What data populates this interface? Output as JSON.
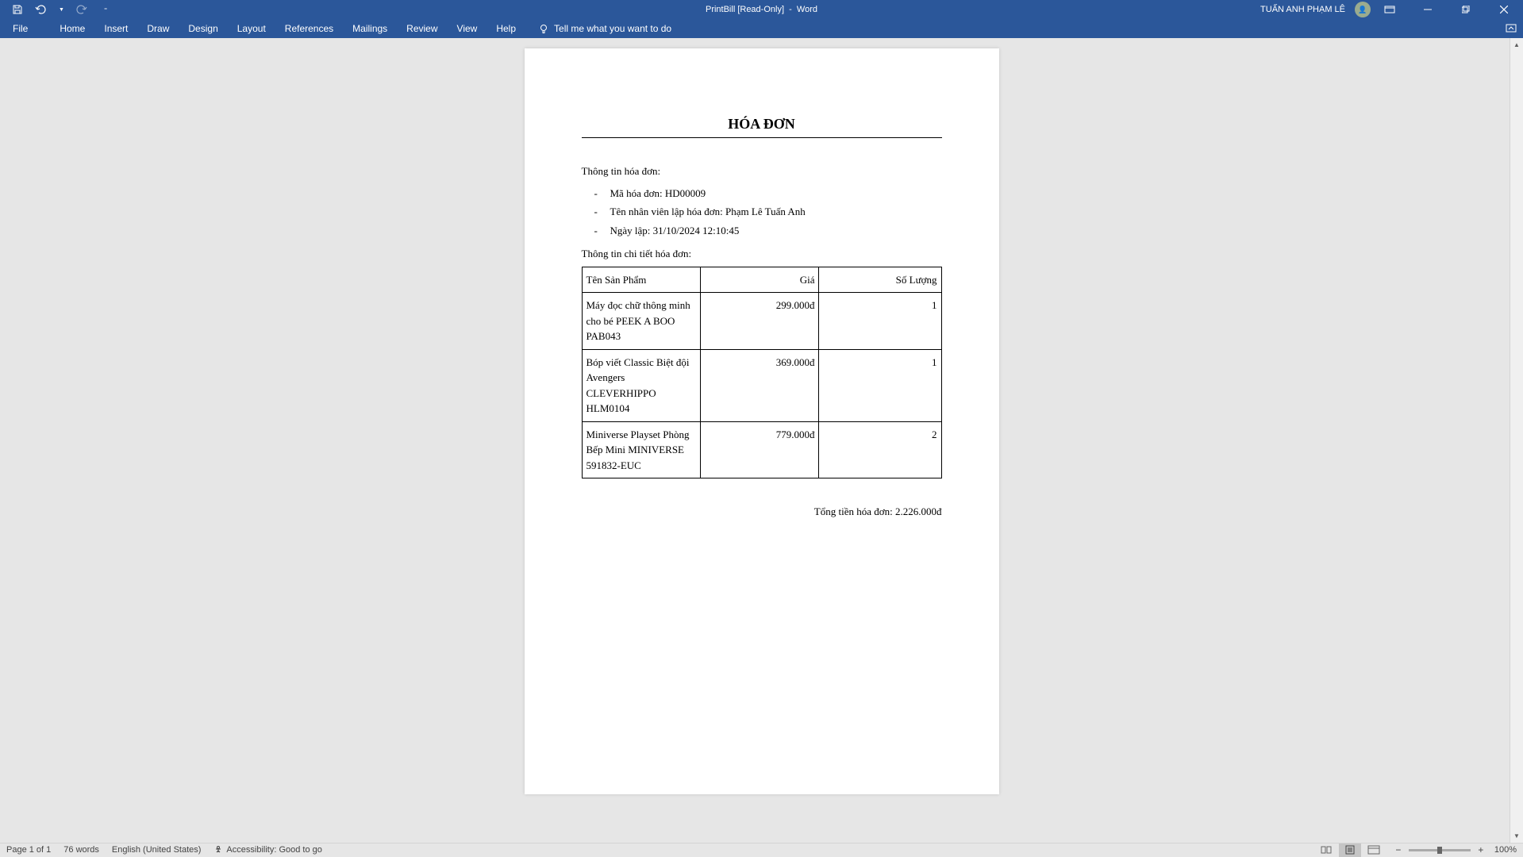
{
  "titleBar": {
    "docName": "PrintBill [Read-Only]",
    "appName": "Word",
    "userName": "TUẤN ANH PHẠM LÊ"
  },
  "ribbon": {
    "tabs": {
      "file": "File",
      "home": "Home",
      "insert": "Insert",
      "draw": "Draw",
      "design": "Design",
      "layout": "Layout",
      "references": "References",
      "mailings": "Mailings",
      "review": "Review",
      "view": "View",
      "help": "Help"
    },
    "tellMe": "Tell me what you want to do"
  },
  "document": {
    "title": "HÓA ĐƠN",
    "infoLabel": "Thông tin hóa đơn:",
    "info": {
      "billCodeLabel": "Mã hóa đơn: ",
      "billCode": "HD00009",
      "staffLabel": "Tên nhân viên lập hóa đơn: ",
      "staffName": "Phạm Lê Tuấn Anh",
      "dateLabel": "Ngày lập: ",
      "dateValue": "31/10/2024 12:10:45"
    },
    "detailLabel": "Thông tin chi tiết hóa đơn:",
    "tableHeaders": {
      "name": "Tên Sản Phẩm",
      "price": "Giá",
      "qty": "Số Lượng"
    },
    "items": [
      {
        "name": "Máy đọc chữ thông minh cho bé PEEK A BOO PAB043",
        "price": "299.000đ",
        "qty": "1"
      },
      {
        "name": "Bóp viết Classic Biệt đội Avengers CLEVERHIPPO HLM0104",
        "price": "369.000đ",
        "qty": "1"
      },
      {
        "name": "Miniverse Playset Phòng Bếp Mini MINIVERSE 591832-EUC",
        "price": "779.000đ",
        "qty": "2"
      }
    ],
    "totalLabel": "Tổng tiền hóa đơn: ",
    "totalValue": "2.226.000đ"
  },
  "statusBar": {
    "page": "Page 1 of 1",
    "words": "76 words",
    "language": "English (United States)",
    "accessibility": "Accessibility: Good to go",
    "zoom": "100%"
  }
}
